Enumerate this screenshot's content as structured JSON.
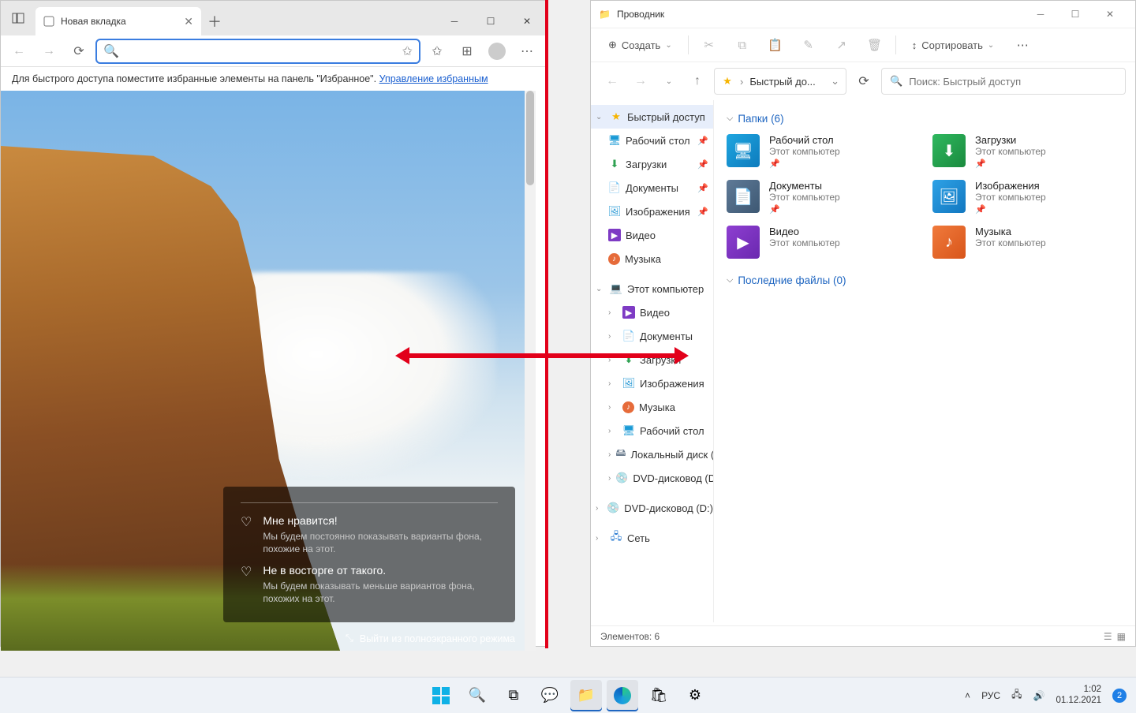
{
  "edge": {
    "tab_title": "Новая вкладка",
    "fav_hint_text": "Для быстрого доступа поместите избранные элементы на панель \"Избранное\".",
    "fav_hint_link": "Управление избранным",
    "feedback": {
      "like_title": "Мне нравится!",
      "like_sub": "Мы будем постоянно показывать варианты фона, похожие на этот.",
      "dislike_title": "Не в восторге от такого.",
      "dislike_sub": "Мы будем показывать меньше вариантов фона, похожих на этот."
    },
    "exit_fullscreen": "Выйти из полноэкранного режима"
  },
  "explorer": {
    "title": "Проводник",
    "ribbon": {
      "create": "Создать",
      "sort": "Сортировать"
    },
    "breadcrumb": "Быстрый до...",
    "search_placeholder": "Поиск: Быстрый доступ",
    "tree": {
      "quick": "Быстрый доступ",
      "desktop": "Рабочий стол",
      "downloads": "Загрузки",
      "documents": "Документы",
      "pictures": "Изображения",
      "videos": "Видео",
      "music": "Музыка",
      "pc": "Этот компьютер",
      "pc_videos": "Видео",
      "pc_documents": "Документы",
      "pc_downloads": "Загрузки",
      "pc_pictures": "Изображения",
      "pc_music": "Музыка",
      "pc_desktop": "Рабочий стол",
      "pc_localdisk": "Локальный диск (",
      "pc_dvd": "DVD-дисковод (D:",
      "dvd2": "DVD-дисковод (D:)",
      "network": "Сеть"
    },
    "section_folders": "Папки (6)",
    "section_recent": "Последние файлы (0)",
    "folder_sub": "Этот компьютер",
    "folders": {
      "desktop": "Рабочий стол",
      "downloads": "Загрузки",
      "documents": "Документы",
      "pictures": "Изображения",
      "videos": "Видео",
      "music": "Музыка"
    },
    "status": "Элементов: 6"
  },
  "taskbar": {
    "lang": "РУС",
    "time": "1:02",
    "date": "01.12.2021",
    "badge": "2"
  }
}
